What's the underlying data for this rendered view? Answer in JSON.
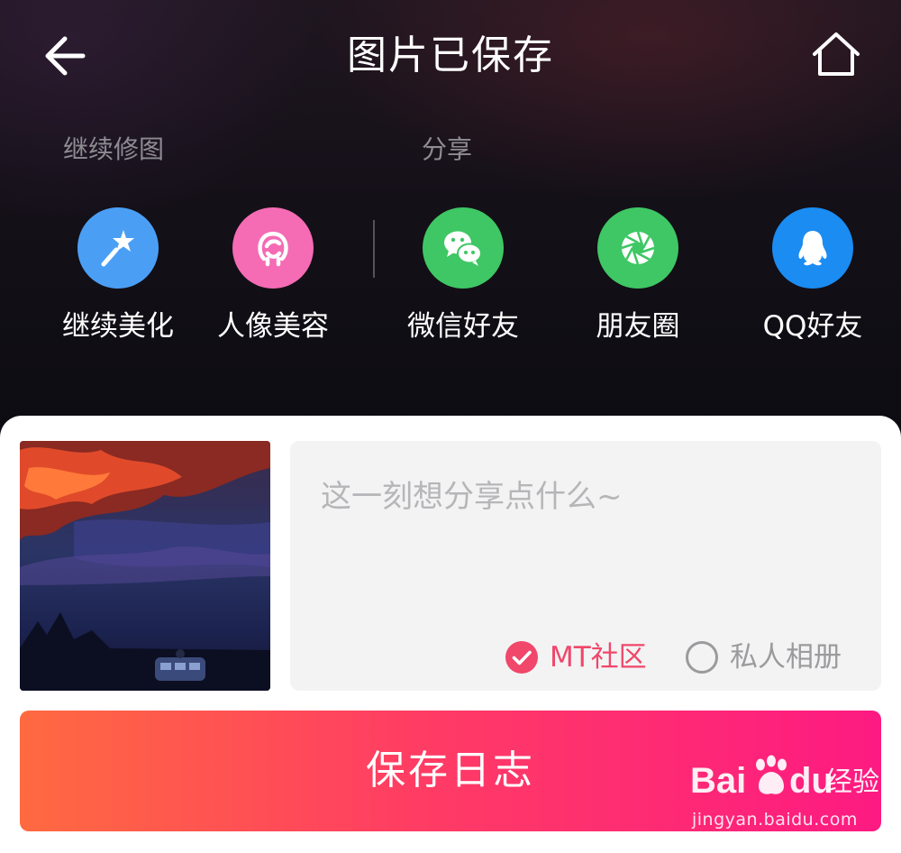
{
  "header": {
    "title": "图片已保存",
    "back_icon": "arrow-left-icon",
    "home_icon": "home-icon"
  },
  "sections": {
    "edit_label": "继续修图",
    "share_label": "分享"
  },
  "edit_actions": [
    {
      "label": "继续美化",
      "icon": "magic-wand-icon",
      "color": "#4a9ff5"
    },
    {
      "label": "人像美容",
      "icon": "face-outline-icon",
      "color": "#f56bb4"
    }
  ],
  "share_actions": [
    {
      "label": "微信好友",
      "icon": "wechat-icon",
      "color": "#3ec764"
    },
    {
      "label": "朋友圈",
      "icon": "moments-shutter-icon",
      "color": "#3ec764"
    },
    {
      "label": "QQ好友",
      "icon": "qq-penguin-icon",
      "color": "#1a8cf2"
    }
  ],
  "post": {
    "placeholder": "这一刻想分享点什么~",
    "options": [
      {
        "label": "MT社区",
        "selected": true,
        "color": "#f0476a"
      },
      {
        "label": "私人相册",
        "selected": false,
        "color": "#9b9b9e"
      }
    ]
  },
  "save_button": {
    "label": "保存日志",
    "gradient_start": "#ff6a40",
    "gradient_end": "#fd1a82"
  },
  "watermark": {
    "brand_a": "Bai",
    "brand_b": "du",
    "brand_c": "经验",
    "url": "jingyan.baidu.com"
  }
}
